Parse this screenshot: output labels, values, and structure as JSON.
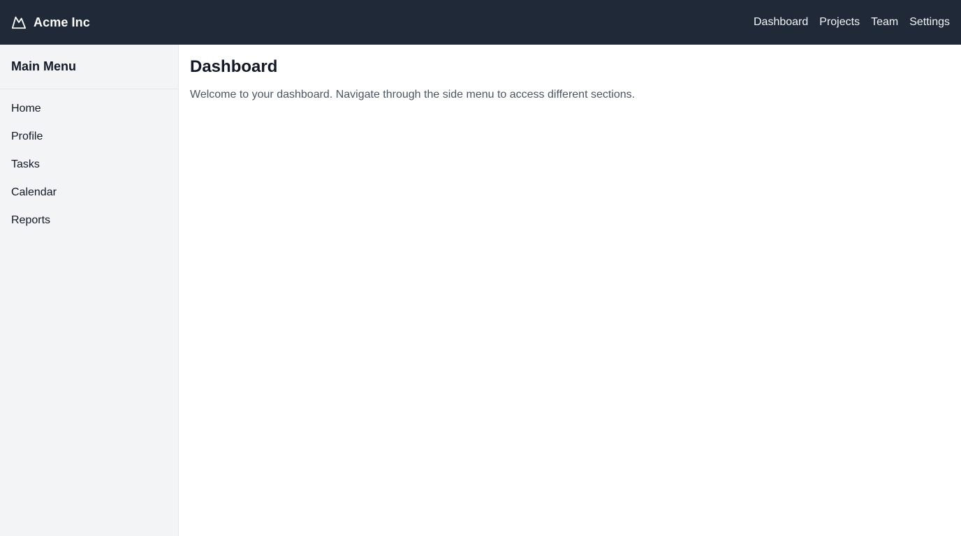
{
  "header": {
    "brand": {
      "logo_icon": "mountain-icon",
      "name": "Acme Inc"
    },
    "nav": [
      {
        "label": "Dashboard"
      },
      {
        "label": "Projects"
      },
      {
        "label": "Team"
      },
      {
        "label": "Settings"
      }
    ]
  },
  "sidebar": {
    "title": "Main Menu",
    "items": [
      {
        "label": "Home"
      },
      {
        "label": "Profile"
      },
      {
        "label": "Tasks"
      },
      {
        "label": "Calendar"
      },
      {
        "label": "Reports"
      }
    ]
  },
  "main": {
    "title": "Dashboard",
    "description": "Welcome to your dashboard. Navigate through the side menu to access different sections."
  },
  "colors": {
    "topbar_bg": "#1f2937",
    "sidebar_bg": "#f3f4f6",
    "text_primary": "#111827",
    "text_secondary": "#4b5563"
  }
}
